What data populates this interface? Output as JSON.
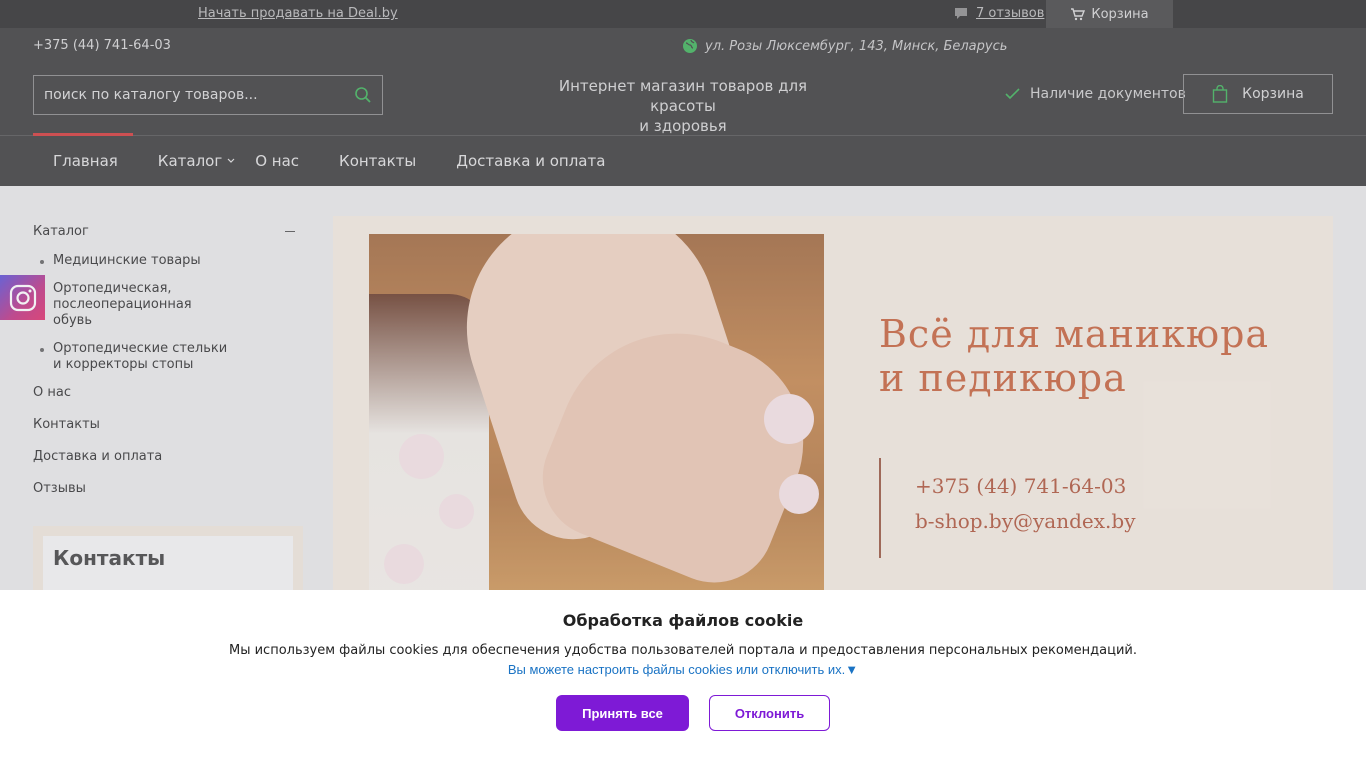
{
  "topbar": {
    "sell_link": "Начать продавать на Deal.by",
    "reviews": "7 отзывов",
    "cart": "Корзина"
  },
  "header": {
    "phone": "+375 (44) 741-64-03",
    "address": "ул. Розы Люксембург, 143, Минск, Беларусь",
    "search_placeholder": "поиск по каталогу товаров...",
    "slogan_line1": "Интернет магазин товаров для красоты",
    "slogan_line2": "и здоровья",
    "documents": "Наличие документов",
    "cart": "Корзина"
  },
  "nav": {
    "items": [
      "Главная",
      "Каталог",
      "О нас",
      "Контакты",
      "Доставка и оплата"
    ]
  },
  "sidebar": {
    "catalog": "Каталог",
    "subcategories": [
      "Медицинские товары",
      "Ортопедическая, послеоперационная обувь",
      "Ортопедические стельки и корректоры стопы"
    ],
    "links": [
      "О нас",
      "Контакты",
      "Доставка и оплата",
      "Отзывы"
    ],
    "contacts_title": "Контакты"
  },
  "banner": {
    "title_line1": "Всё для маникюра",
    "title_line2": "и педикюра",
    "phone": "+375 (44) 741-64-03",
    "email": "b-shop.by@yandex.by"
  },
  "cookie": {
    "title": "Обработка файлов cookie",
    "text": "Мы используем файлы cookies для обеспечения удобства пользователей портала и предоставления персональных рекомендаций.",
    "settings_link": "Вы можете настроить файлы cookies или отключить их.▼",
    "accept": "Принять все",
    "decline": "Отклонить"
  },
  "colors": {
    "header_bg": "#3d3d3d",
    "accent_green": "#3fb35a",
    "active_underline": "#d33b3b",
    "banner_text": "#c7643f",
    "cookie_button": "#7e1ad6"
  }
}
